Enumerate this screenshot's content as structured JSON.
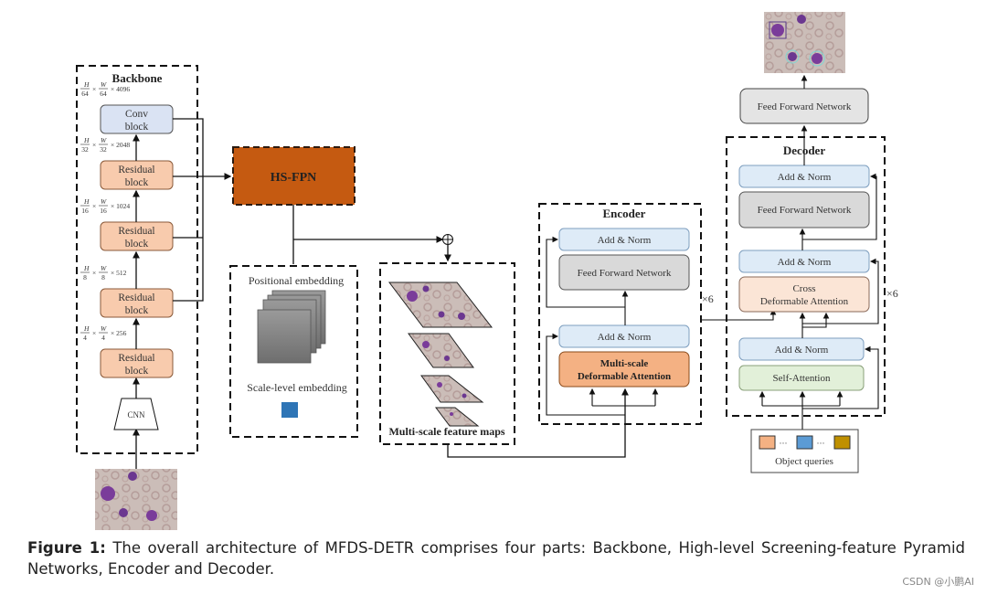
{
  "backbone": {
    "title": "Backbone",
    "blocks": [
      {
        "label_line1": "Conv",
        "label_line2": "block",
        "dim": "H/64 × W/64 × 4096",
        "h_den": "64",
        "w_den": "64",
        "ch": "× 4096"
      },
      {
        "label_line1": "Residual",
        "label_line2": "block",
        "dim": "H/32 × W/32 × 2048",
        "h_den": "32",
        "w_den": "32",
        "ch": "× 2048"
      },
      {
        "label_line1": "Residual",
        "label_line2": "block",
        "dim": "H/16 × W/16 × 1024",
        "h_den": "16",
        "w_den": "16",
        "ch": "× 1024"
      },
      {
        "label_line1": "Residual",
        "label_line2": "block",
        "dim": "H/8 × W/8 × 512",
        "h_den": "8",
        "w_den": "8",
        "ch": "× 512"
      },
      {
        "label_line1": "Residual",
        "label_line2": "block",
        "dim": "H/4 × W/4 × 256",
        "h_den": "4",
        "w_den": "4",
        "ch": "× 256"
      }
    ],
    "cnn_label": "CNN",
    "frac_h": "H",
    "frac_w": "W",
    "times": "×"
  },
  "hsfpn": {
    "label": "HS-FPN"
  },
  "embedding": {
    "positional_label": "Positional embedding",
    "scale_label": "Scale-level embedding"
  },
  "feature_maps": {
    "label": "Multi-scale feature maps"
  },
  "add_symbol": "⊕",
  "encoder": {
    "title": "Encoder",
    "add_norm_top": "Add & Norm",
    "ffn": "Feed Forward Network",
    "add_norm_bottom": "Add & Norm",
    "msda_line1": "Multi-scale",
    "msda_line2": "Deformable Attention",
    "repeat": "×6"
  },
  "decoder": {
    "title": "Decoder",
    "add_norm_1": "Add & Norm",
    "ffn": "Feed Forward Network",
    "add_norm_2": "Add & Norm",
    "cross_line1": "Cross",
    "cross_line2": "Deformable Attention",
    "add_norm_3": "Add & Norm",
    "self_attention": "Self-Attention",
    "repeat": "×6"
  },
  "output_ffn": "Feed Forward Network",
  "object_queries": {
    "label": "Object queries",
    "ellipsis": "···"
  },
  "colors": {
    "residual": "#f8cbad",
    "conv": "#dae3f3",
    "hsfpn": "#c55a11",
    "add_norm": "#deebf7",
    "ffn": "#d9d9d9",
    "msda": "#f4b183",
    "cross": "#fbe5d6",
    "self_attn": "#e2f0d9",
    "query1": "#f4b183",
    "query2": "#5b9bd5",
    "query3": "#bf9000",
    "scale_emb": "#2e75b6"
  },
  "caption": {
    "label": "Figure 1:",
    "text": " The overall architecture of MFDS-DETR comprises four parts: Backbone, High-level Screening-feature Pyramid Networks, Encoder and Decoder."
  },
  "watermark": "CSDN @小鹏AI"
}
